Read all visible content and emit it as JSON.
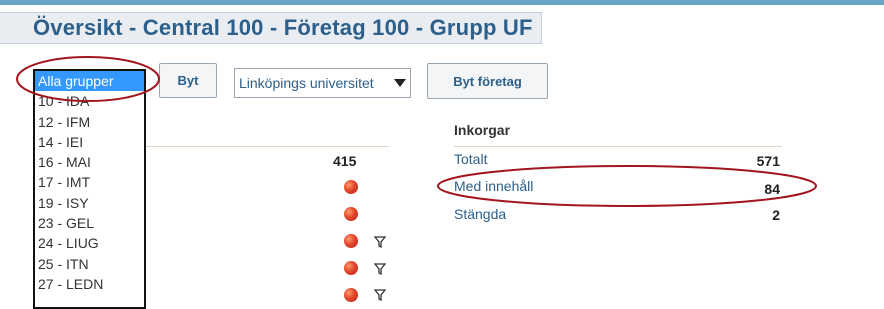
{
  "page": {
    "title": "Översikt - Central 100 - Företag 100 - Grupp UF"
  },
  "toolbar": {
    "byt_label": "Byt",
    "university_selected": "Linköpings universitet",
    "byt_foretag_label": "Byt företag"
  },
  "groups": {
    "items": [
      "Alla grupper",
      "10 - IDA",
      "12 - IFM",
      "14 - IEI",
      "16 - MAI",
      "17 - IMT",
      "19 - ISY",
      "23 - GEL",
      "24 - LIUG",
      "25 - ITN",
      "27 - LEDN"
    ],
    "selected_index": 0
  },
  "left_panel": {
    "count": "415"
  },
  "inbox": {
    "title": "Inkorgar",
    "rows": [
      {
        "label": "Totalt",
        "value": "571"
      },
      {
        "label": "Med innehåll",
        "value": "84"
      },
      {
        "label": "Stängda",
        "value": "2"
      }
    ]
  },
  "colors": {
    "accent": "#2c5f8a",
    "selected": "#3399ff",
    "highlight_ellipse": "#a3151c",
    "status_dot": "#e2452b"
  },
  "icons": [
    "status-dot-icon",
    "filter-icon",
    "chevron-down-icon"
  ]
}
